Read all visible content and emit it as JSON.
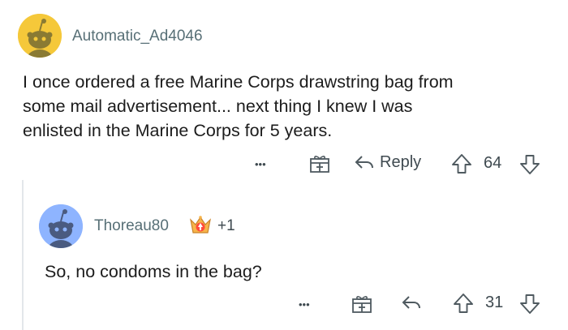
{
  "comment": {
    "author": "Automatic_Ad4046",
    "body_lines": [
      "I once ordered a free Marine Corps drawstring bag from",
      "some mail advertisement... next thing I knew I was",
      "enlisted in the Marine Corps for 5 years."
    ],
    "more_label": "•••",
    "reply_label": "Reply",
    "score": "64",
    "avatar_color": "#f5c83a"
  },
  "reply": {
    "author": "Thoreau80",
    "award_count": "+1",
    "body": "So, no condoms in the bag?",
    "more_label": "•••",
    "score": "31",
    "avatar_color": "#8eb4ff"
  },
  "icons": {
    "more": "more-icon",
    "gift": "gift-icon",
    "reply": "reply-arrow-icon",
    "upvote": "upvote-icon",
    "downvote": "downvote-icon",
    "award": "award-icon"
  }
}
